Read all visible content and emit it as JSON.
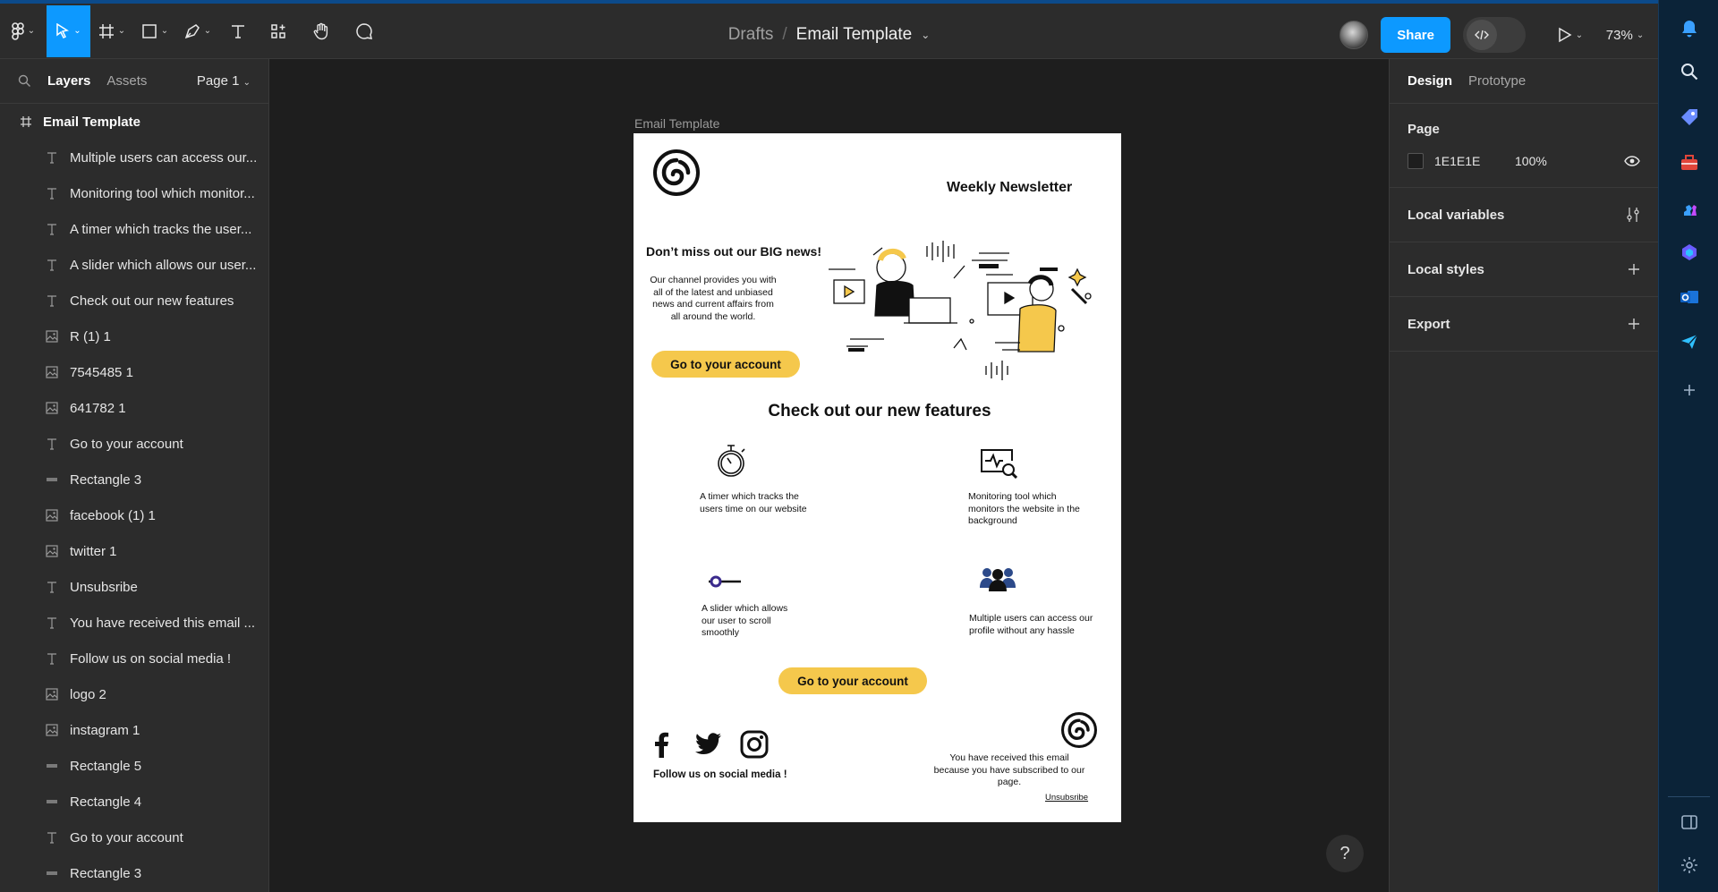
{
  "toolbar": {
    "breadcrumb_parent": "Drafts",
    "breadcrumb_separator": "/",
    "file_title": "Email Template",
    "share_label": "Share",
    "zoom": "73%"
  },
  "left_panel": {
    "tab_layers": "Layers",
    "tab_assets": "Assets",
    "page_select": "Page 1",
    "root_layer": "Email Template",
    "layers": [
      {
        "type": "text",
        "label": "Multiple users can access our..."
      },
      {
        "type": "text",
        "label": "Monitoring tool which monitor..."
      },
      {
        "type": "text",
        "label": "A timer which tracks the user..."
      },
      {
        "type": "text",
        "label": "A slider which allows our user..."
      },
      {
        "type": "text",
        "label": "Check out our new features"
      },
      {
        "type": "image",
        "label": "R (1) 1"
      },
      {
        "type": "image",
        "label": "7545485 1"
      },
      {
        "type": "image",
        "label": "641782 1"
      },
      {
        "type": "text",
        "label": "Go to your account"
      },
      {
        "type": "rect",
        "label": "Rectangle 3"
      },
      {
        "type": "image",
        "label": "facebook (1) 1"
      },
      {
        "type": "image",
        "label": "twitter 1"
      },
      {
        "type": "text",
        "label": "Unsubsribe"
      },
      {
        "type": "text",
        "label": "You have received this email ..."
      },
      {
        "type": "text",
        "label": "Follow us on social media !"
      },
      {
        "type": "image",
        "label": "logo 2"
      },
      {
        "type": "image",
        "label": "instagram 1"
      },
      {
        "type": "rect",
        "label": "Rectangle 5"
      },
      {
        "type": "rect",
        "label": "Rectangle 4"
      },
      {
        "type": "text",
        "label": "Go to your account"
      },
      {
        "type": "rect",
        "label": "Rectangle 3"
      }
    ]
  },
  "canvas": {
    "frame_label": "Email Template",
    "help": "?"
  },
  "email": {
    "title": "Weekly Newsletter",
    "heading": "Don’t miss out our BIG news!",
    "body": "Our channel provides you with all of the latest and unbiased news and current affairs from all around the world.",
    "cta_top": "Go to your account",
    "features_title": "Check out our new features",
    "feature_timer": "A timer which tracks the users time on our website",
    "feature_monitor": "Monitoring tool which monitors the website in the background",
    "feature_slider": "A slider which allows our user to scroll smoothly",
    "feature_users": "Multiple users can access our profile without any hassle",
    "cta_bottom": "Go to your account",
    "social_label": "Follow us on social media !",
    "received": "You have received this email because you have subscribed to our page.",
    "unsubscribe": "Unsubsribe",
    "accent_color": "#f5c84c"
  },
  "right_panel": {
    "tab_design": "Design",
    "tab_prototype": "Prototype",
    "page_title": "Page",
    "page_color_hex": "1E1E1E",
    "page_opacity": "100%",
    "local_variables": "Local variables",
    "local_styles": "Local styles",
    "export": "Export"
  },
  "colors": {
    "toolbar_bg": "#2c2c2c",
    "canvas_bg": "#1e1e1e",
    "accent_blue": "#0d99ff",
    "rail_bg": "#0b2338"
  }
}
